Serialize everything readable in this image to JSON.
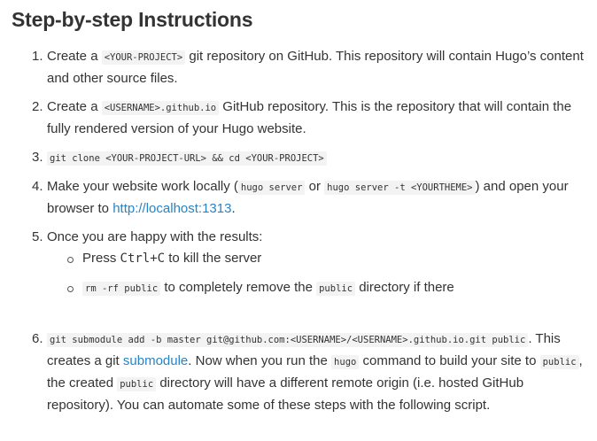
{
  "title": "Step-by-step Instructions",
  "steps": [
    {
      "number": "1.",
      "prefix": "Create a ",
      "code": "<YOUR-PROJECT>",
      "suffix": " git repository on GitHub. This repository will contain Hugo’s content and other source files."
    },
    {
      "number": "2.",
      "prefix": "Create a ",
      "code": "<USERNAME>.github.io",
      "suffix": " GitHub repository. This is the repository that will contain the fully rendered version of your Hugo website."
    },
    {
      "number": "3.",
      "code": "git clone <YOUR-PROJECT-URL> && cd <YOUR-PROJECT>"
    },
    {
      "number": "4.",
      "prefix": "Make your website work locally (",
      "code1": "hugo server",
      "mid": " or ",
      "code2": "hugo server -t <YOURTHEME>",
      "suffix": ") and open your browser to ",
      "link": "http://localhost:1313",
      "end": "."
    },
    {
      "number": "5.",
      "text": "Once you are happy with the results:",
      "sub1_prefix": "Press ",
      "sub1_key": "Ctrl+C",
      "sub1_suffix": " to kill the server",
      "sub2_code1": "rm -rf public",
      "sub2_mid": " to completely remove the ",
      "sub2_code2": "public",
      "sub2_suffix": " directory if there"
    },
    {
      "number": "6.",
      "code": "git submodule add -b master git@github.com:<USERNAME>/<USERNAME>.github.io.git public",
      "text1": ". This creates a git ",
      "link": "submodule",
      "text2": ". Now when you run the ",
      "code2": "hugo",
      "text3": " command to build your site to ",
      "code3": "public",
      "text4": ", the created ",
      "code4": "public",
      "text5": " directory will have a different remote origin (i.e. hosted GitHub repository). You can automate some of these steps with the following script."
    }
  ]
}
